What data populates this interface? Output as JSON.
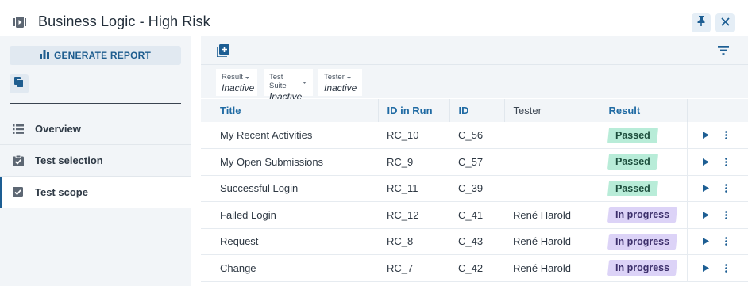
{
  "header": {
    "title": "Business Logic - High Risk",
    "icons": [
      "video-icon",
      "pin-icon",
      "close-icon"
    ]
  },
  "sidebar": {
    "generate_report_label": "GENERATE REPORT",
    "items": [
      {
        "label": "Overview",
        "icon": "list-icon",
        "active": false
      },
      {
        "label": "Test selection",
        "icon": "clipboard-check-icon",
        "active": false
      },
      {
        "label": "Test scope",
        "icon": "checkbox-icon",
        "active": true
      }
    ]
  },
  "filters": [
    {
      "key": "Result",
      "value": "Inactive"
    },
    {
      "key": "Test Suite",
      "value": "Inactive"
    },
    {
      "key": "Tester",
      "value": "Inactive"
    }
  ],
  "table": {
    "columns": [
      "Title",
      "ID in Run",
      "ID",
      "Tester",
      "Result"
    ],
    "rows": [
      {
        "title": "My Recent Activities",
        "id_in_run": "RC_10",
        "id": "C_56",
        "tester": "",
        "result": "Passed"
      },
      {
        "title": "My Open Submissions",
        "id_in_run": "RC_9",
        "id": "C_57",
        "tester": "",
        "result": "Passed"
      },
      {
        "title": "Successful Login",
        "id_in_run": "RC_11",
        "id": "C_39",
        "tester": "",
        "result": "Passed"
      },
      {
        "title": "Failed Login",
        "id_in_run": "RC_12",
        "id": "C_41",
        "tester": "René Harold",
        "result": "In progress"
      },
      {
        "title": "Request",
        "id_in_run": "RC_8",
        "id": "C_43",
        "tester": "René Harold",
        "result": "In progress"
      },
      {
        "title": "Change",
        "id_in_run": "RC_7",
        "id": "C_42",
        "tester": "René Harold",
        "result": "In progress"
      }
    ]
  },
  "colors": {
    "accent": "#1d5e93",
    "passed_bg": "#b8ecd8",
    "in_progress_bg": "#dcd3f7",
    "panel_bg": "#f2f5f8"
  }
}
